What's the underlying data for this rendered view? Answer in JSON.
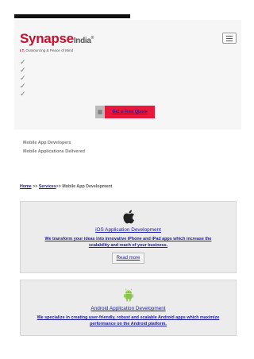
{
  "brand": {
    "name_part1": "Synapse",
    "name_part2": "India",
    "trademark": "®",
    "tagline_prefix": "I.T.",
    "tagline_rest": "Outsourcing & Peace of Mind",
    "red": "#c8102e"
  },
  "hero": {
    "quote_button": "Get a Free Quote"
  },
  "side_links": [
    "Mobile App Developers",
    "Mobile Applications Delivered"
  ],
  "breadcrumb": {
    "home": "Home",
    "sep1": ">>",
    "services": "Services",
    "sep2": ">>",
    "current": "Mobile App Development"
  },
  "services": [
    {
      "icon": "apple-icon",
      "title": "iOS Application Development",
      "description": "We transform your ideas into innovative iPhone and iPad apps which increase the scalability and reach of your business.",
      "button": "Read more"
    },
    {
      "icon": "android-icon",
      "title": "Android Application Development",
      "description": "We specialize in creating user-friendly, robust and scalable Android  apps which maximize performance on the Android platform."
    }
  ],
  "colors": {
    "link": "#1a1aa8",
    "accent": "#e8173c",
    "android_green": "#8bc34a"
  }
}
